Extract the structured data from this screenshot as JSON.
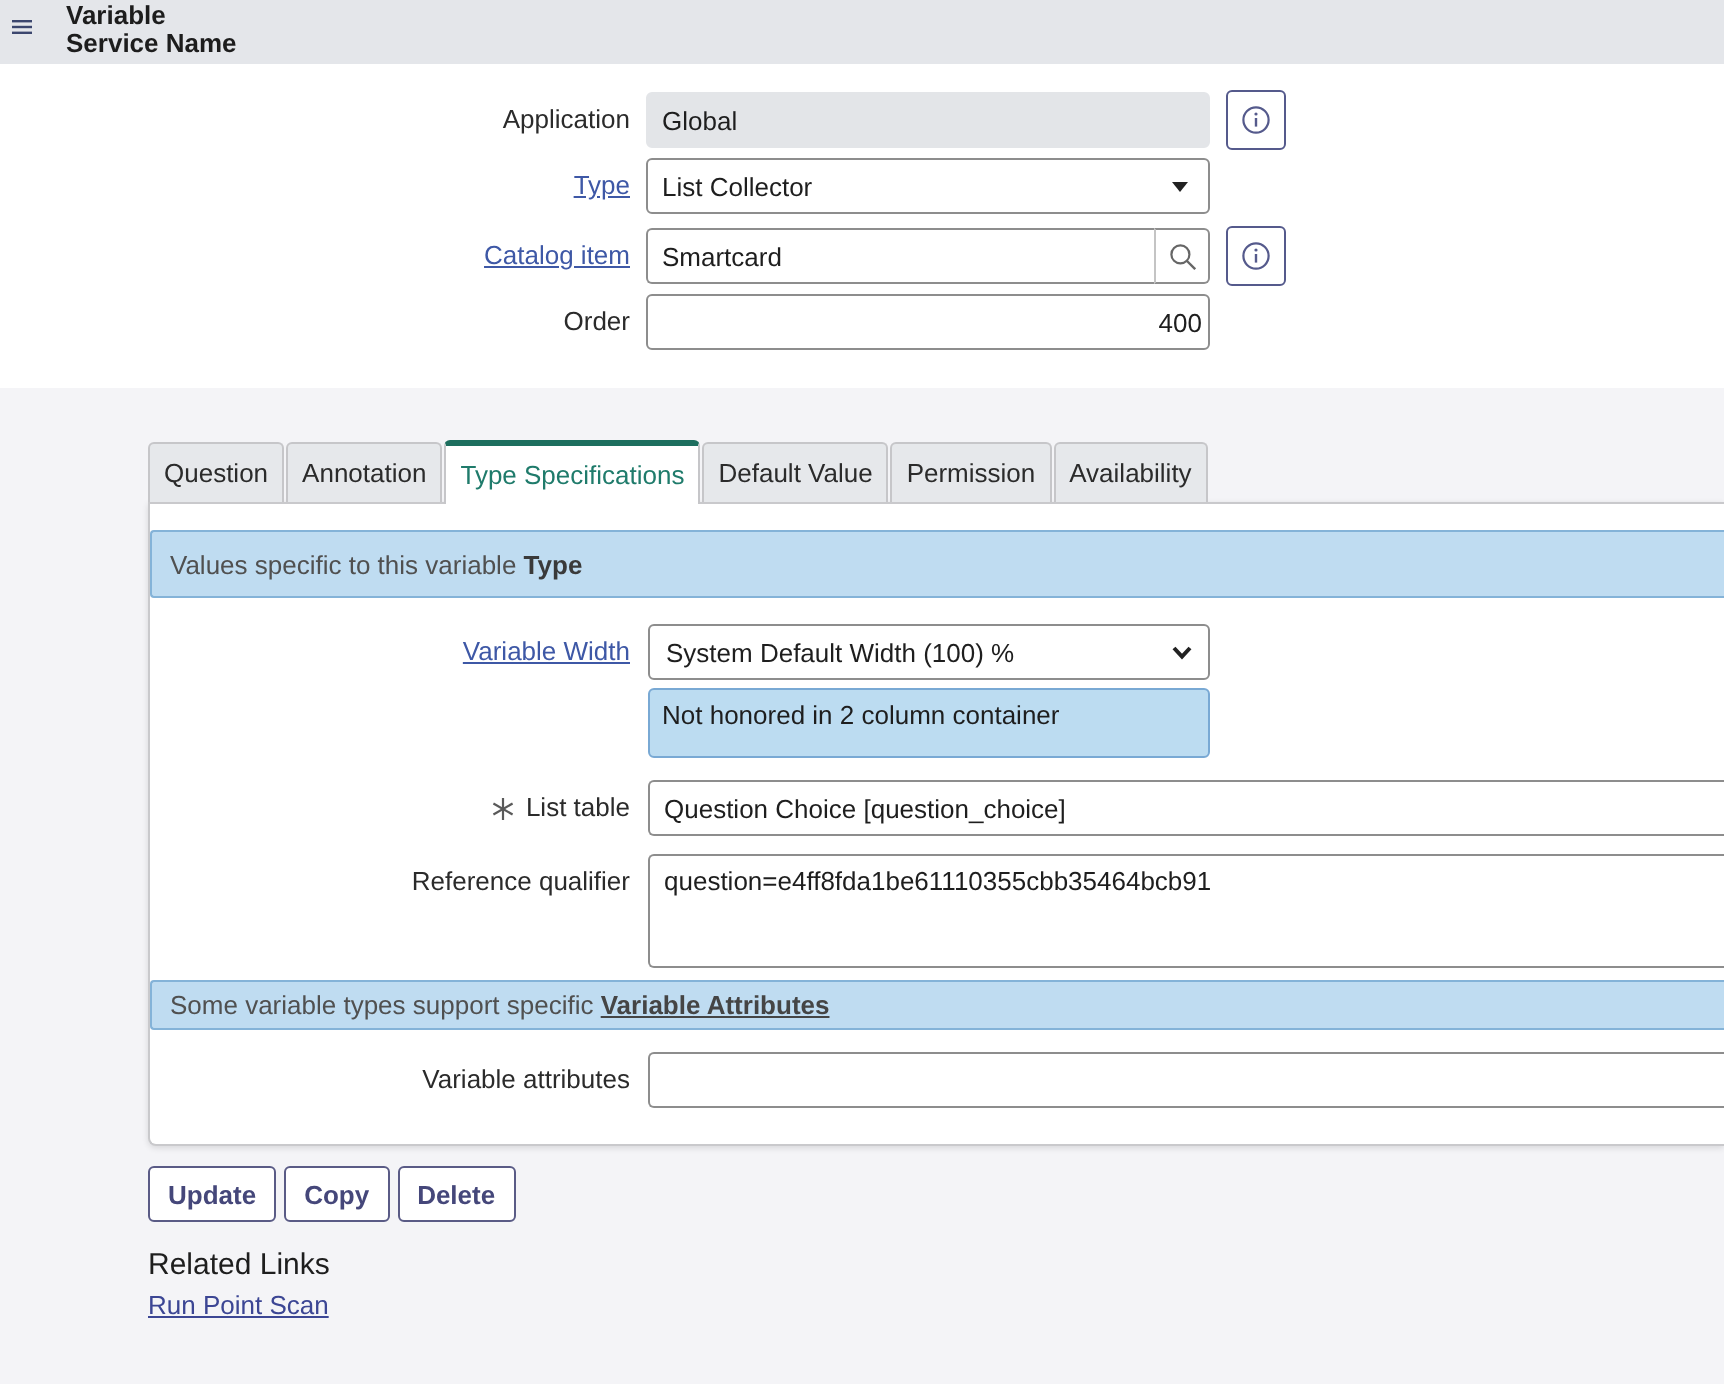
{
  "header": {
    "record_type": "Variable",
    "record_name": "Service Name"
  },
  "fields": [
    {
      "kind": "readonly",
      "label": "Application",
      "label_link": false,
      "value": "Global",
      "info_button": true
    },
    {
      "kind": "select",
      "label": "Type",
      "label_link": true,
      "value": "List Collector",
      "info_button": false
    },
    {
      "kind": "reference",
      "label": "Catalog item",
      "label_link": true,
      "value": "Smartcard",
      "info_button": true
    },
    {
      "kind": "number",
      "label": "Order",
      "label_link": false,
      "value": "400",
      "info_button": false
    }
  ],
  "tabs": [
    {
      "label": "Question",
      "selected": false
    },
    {
      "label": "Annotation",
      "selected": false
    },
    {
      "label": "Type Specifications",
      "selected": true
    },
    {
      "label": "Default Value",
      "selected": false
    },
    {
      "label": "Permission",
      "selected": false
    },
    {
      "label": "Availability",
      "selected": false
    }
  ],
  "tab_panel": [
    {
      "kind": "banner",
      "text": "Values specific to this variable **Type**"
    },
    {
      "kind": "select",
      "label": "Variable Width",
      "label_link": true,
      "mandatory": false,
      "value": "System Default Width (100) %",
      "note": "Not honored in 2 column container"
    },
    {
      "kind": "text",
      "label": "List table",
      "label_link": false,
      "mandatory": true,
      "value": "Question Choice [question_choice]"
    },
    {
      "kind": "textarea",
      "label": "Reference qualifier",
      "label_link": false,
      "mandatory": false,
      "value": "question=e4ff8fda1be61110355cbb35464bcb91"
    },
    {
      "kind": "banner",
      "text": "Some variable types support specific",
      "link": "Variable Attributes"
    },
    {
      "kind": "text",
      "label": "Variable attributes",
      "label_link": false,
      "mandatory": false
    }
  ],
  "buttons": [
    "Update",
    "Copy",
    "Delete"
  ],
  "related_links": {
    "title": "Related Links",
    "links": [
      "Run Point Scan"
    ]
  }
}
